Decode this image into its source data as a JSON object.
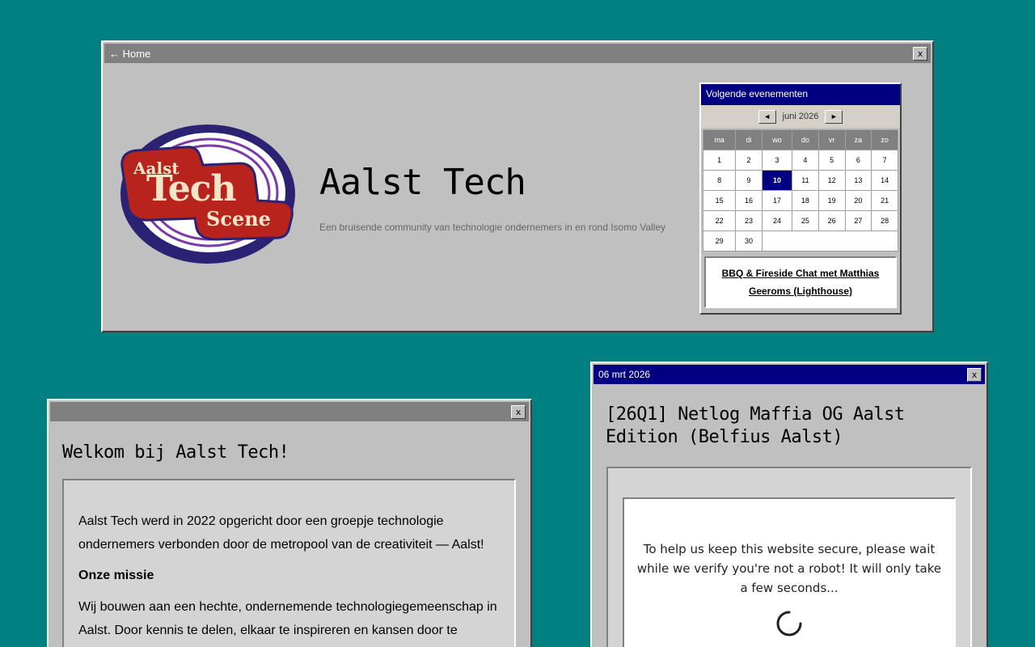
{
  "header_window": {
    "back_label": "← Home",
    "close_label": "x",
    "logo": {
      "line1": "Aalst",
      "line2": "Tech",
      "line3": "Scene"
    },
    "site_title": "Aalst Tech",
    "site_subtitle": "Een bruisende community van technologie ondernemers in en rond Isomo Valley"
  },
  "calendar": {
    "heading": "Volgende evenementen",
    "month_label": "juni 2026",
    "prev_label": "◄",
    "next_label": "►",
    "weekdays": [
      "ma",
      "di",
      "wo",
      "do",
      "vr",
      "za",
      "zo"
    ],
    "weeks": [
      [
        "1",
        "2",
        "3",
        "4",
        "5",
        "6",
        "7"
      ],
      [
        "8",
        "9",
        "10",
        "11",
        "12",
        "13",
        "14"
      ],
      [
        "15",
        "16",
        "17",
        "18",
        "19",
        "20",
        "21"
      ],
      [
        "22",
        "23",
        "24",
        "25",
        "26",
        "27",
        "28"
      ],
      [
        "29",
        "30",
        "",
        "",
        "",
        "",
        ""
      ]
    ],
    "selected_day": "10",
    "event_link": "BBQ & Fireside Chat met Matthias Geeroms (Lighthouse)"
  },
  "welcome_window": {
    "close_label": "x",
    "title": "Welkom bij Aalst Tech!",
    "intro": "Aalst Tech werd in 2022 opgericht door een groepje technologie ondernemers verbonden door de metropool van de creativiteit — Aalst!",
    "mission_heading": "Onze missie",
    "mission_text": "Wij bouwen aan een hechte, ondernemende technologiegemeenschap in Aalst. Door kennis te delen, elkaar te inspireren en kansen door te"
  },
  "event_window": {
    "date": "06 mrt 2026",
    "close_label": "x",
    "title": "[26Q1] Netlog Maffia OG Aalst Edition (Belfius Aalst)",
    "security_message": "To help us keep this website secure, please wait while we verify you're not a robot! It will only take a few seconds..."
  }
}
